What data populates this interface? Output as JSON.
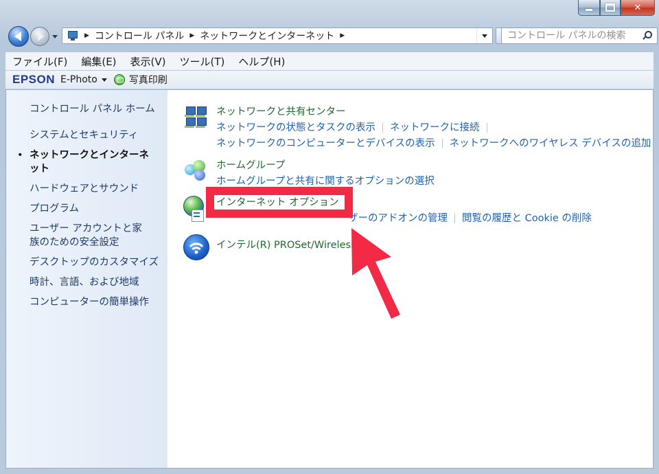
{
  "address": {
    "crumbs": [
      "コントロール パネル",
      "ネットワークとインターネット"
    ]
  },
  "search": {
    "placeholder": "コントロール パネルの検索"
  },
  "menu": [
    "ファイル(F)",
    "編集(E)",
    "表示(V)",
    "ツール(T)",
    "ヘルプ(H)"
  ],
  "epson": {
    "logo": "EPSON",
    "app": "E-Photo",
    "print": "写真印刷"
  },
  "sidebar": {
    "home": "コントロール パネル ホーム",
    "items": [
      {
        "label": "システムとセキュリティ",
        "active": false
      },
      {
        "label": "ネットワークとインターネット",
        "active": true
      },
      {
        "label": "ハードウェアとサウンド",
        "active": false
      },
      {
        "label": "プログラム",
        "active": false
      },
      {
        "label": "ユーザー アカウントと家族のための安全設定",
        "active": false
      },
      {
        "label": "デスクトップのカスタマイズ",
        "active": false
      },
      {
        "label": "時計、言語、および地域",
        "active": false
      },
      {
        "label": "コンピューターの簡単操作",
        "active": false
      }
    ]
  },
  "categories": {
    "network": {
      "title": "ネットワークと共有センター",
      "link1": "ネットワークの状態とタスクの表示",
      "link2": "ネットワークに接続",
      "link3": "ネットワークのコンピューターとデバイスの表示",
      "link4": "ネットワークへのワイヤレス デバイスの追加"
    },
    "homegroup": {
      "title": "ホームグループ",
      "link1": "ホームグループと共有に関するオプションの選択"
    },
    "internet": {
      "title": "インターネット オプション",
      "link1": "ザーのアドオンの管理",
      "link2": "閲覧の履歴と Cookie の削除"
    },
    "intel": {
      "title": "インテル(R) PROSet/Wireless"
    }
  },
  "annotation": {
    "color": "#f32a45"
  }
}
